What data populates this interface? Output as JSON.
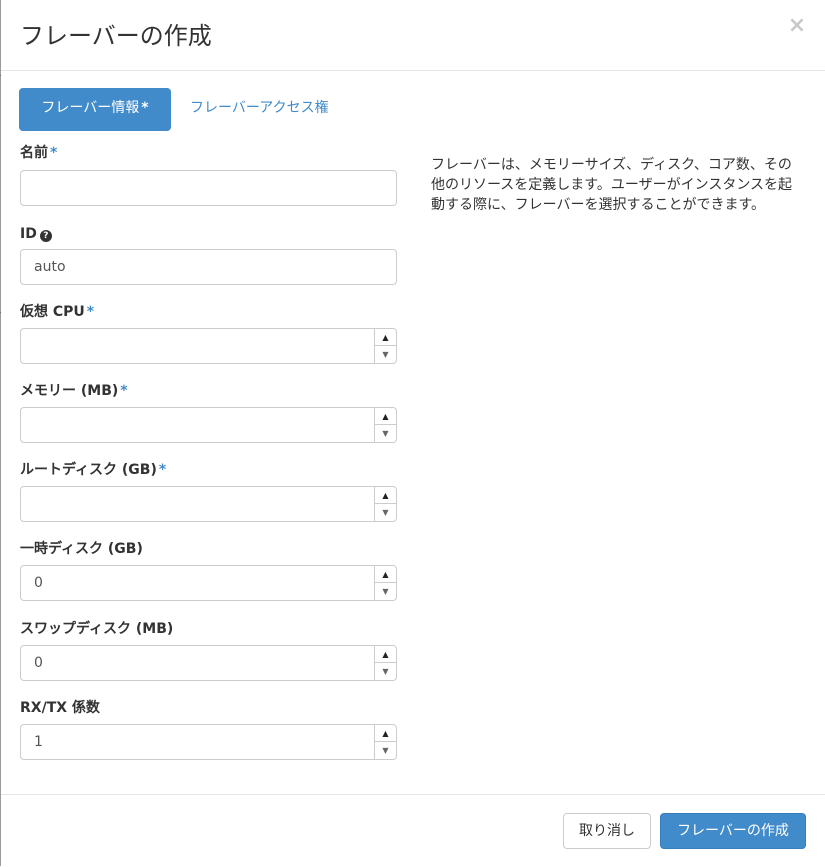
{
  "modal": {
    "title": "フレーバーの作成",
    "close_label": "×"
  },
  "tabs": [
    {
      "label": "フレーバー情報",
      "required_mark": "*",
      "active": true
    },
    {
      "label": "フレーバーアクセス権",
      "active": false
    }
  ],
  "fields": {
    "name": {
      "label": "名前",
      "required_mark": "*",
      "value": ""
    },
    "id": {
      "label": "ID",
      "help_icon": "?",
      "value": "auto"
    },
    "vcpu": {
      "label": "仮想 CPU",
      "required_mark": "*",
      "value": ""
    },
    "memory": {
      "label": "メモリー (MB)",
      "required_mark": "*",
      "value": ""
    },
    "root_disk": {
      "label": "ルートディスク (GB)",
      "required_mark": "*",
      "value": ""
    },
    "ephemeral_disk": {
      "label": "一時ディスク (GB)",
      "value": "0"
    },
    "swap_disk": {
      "label": "スワップディスク (MB)",
      "value": "0"
    },
    "rxtx_factor": {
      "label": "RX/TX 係数",
      "value": "1"
    }
  },
  "spinner": {
    "up": "▲",
    "down": "▼"
  },
  "description": "フレーバーは、メモリーサイズ、ディスク、コア数、その他のリソースを定義します。ユーザーがインスタンスを起動する際に、フレーバーを選択することができます。",
  "footer": {
    "cancel_label": "取り消し",
    "submit_label": "フレーバーの作成"
  },
  "colors": {
    "primary": "#428bca",
    "border": "#cccccc",
    "text": "#333333"
  }
}
